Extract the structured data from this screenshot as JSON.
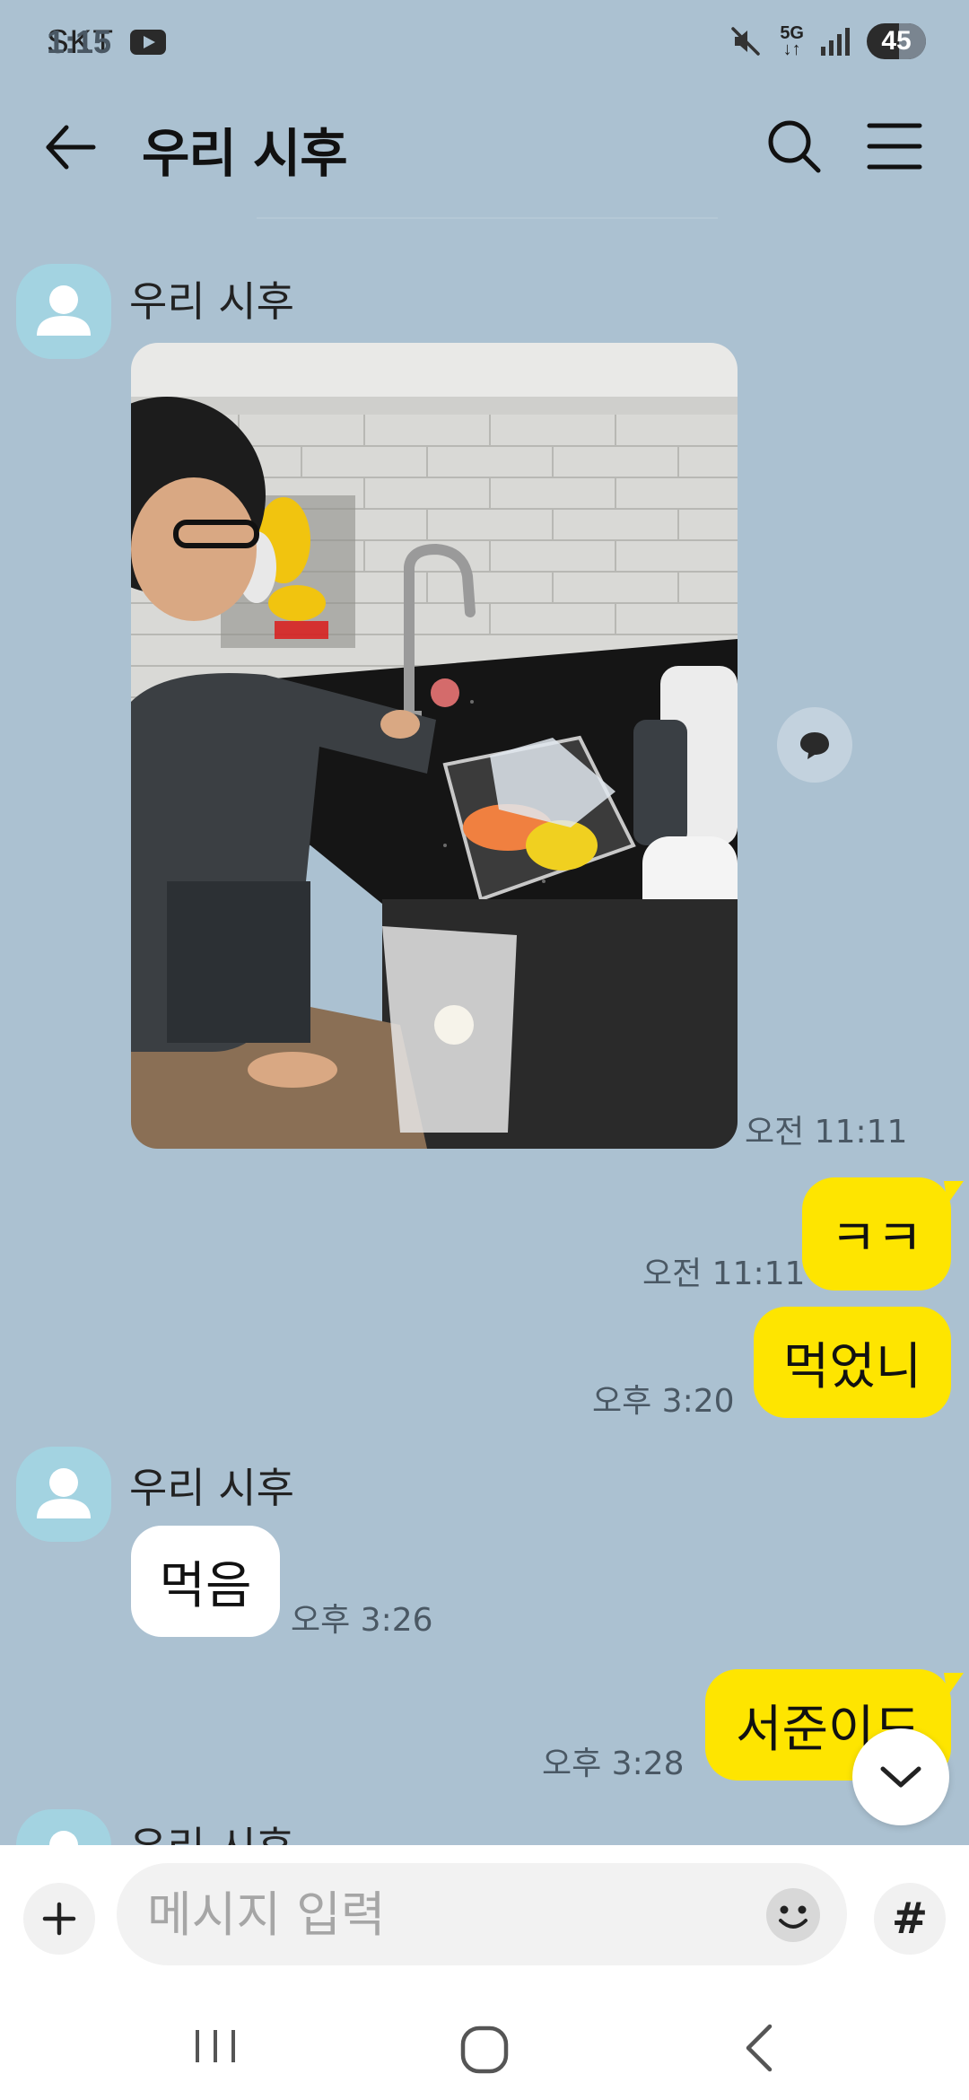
{
  "status_bar": {
    "carrier": "SKT",
    "time": "1:15",
    "network": "5G",
    "battery": "45",
    "icons": [
      "youtube-icon",
      "mute-icon",
      "signal-icon",
      "battery-icon"
    ]
  },
  "header": {
    "title": "우리 시후",
    "icons": [
      "back-arrow-icon",
      "search-icon",
      "menu-icon"
    ]
  },
  "messages": [
    {
      "type": "photo",
      "direction": "in",
      "sender": "우리 시후",
      "time": "오전 11:11"
    },
    {
      "type": "text",
      "direction": "out",
      "text": "ㅋㅋ",
      "time": "오전 11:11"
    },
    {
      "type": "text",
      "direction": "out",
      "text": "먹었니",
      "time": "오후 3:20"
    },
    {
      "type": "text",
      "direction": "in",
      "sender": "우리 시후",
      "text": "먹음",
      "time": "오후 3:26"
    },
    {
      "type": "text",
      "direction": "out",
      "text": "서준이도",
      "time": "오후 3:28"
    },
    {
      "type": "text",
      "direction": "in",
      "sender": "우리 시후"
    }
  ],
  "input_bar": {
    "placeholder": "메시지 입력",
    "value": "",
    "plus_label": "+",
    "hash_label": "#"
  },
  "nav_bar": {
    "icons": [
      "recents-icon",
      "home-icon",
      "back-icon"
    ]
  },
  "colors": {
    "background": "#abc1d1",
    "outgoing_bubble": "#fee500",
    "incoming_bubble": "#ffffff",
    "avatar": "#a3d3e1"
  }
}
